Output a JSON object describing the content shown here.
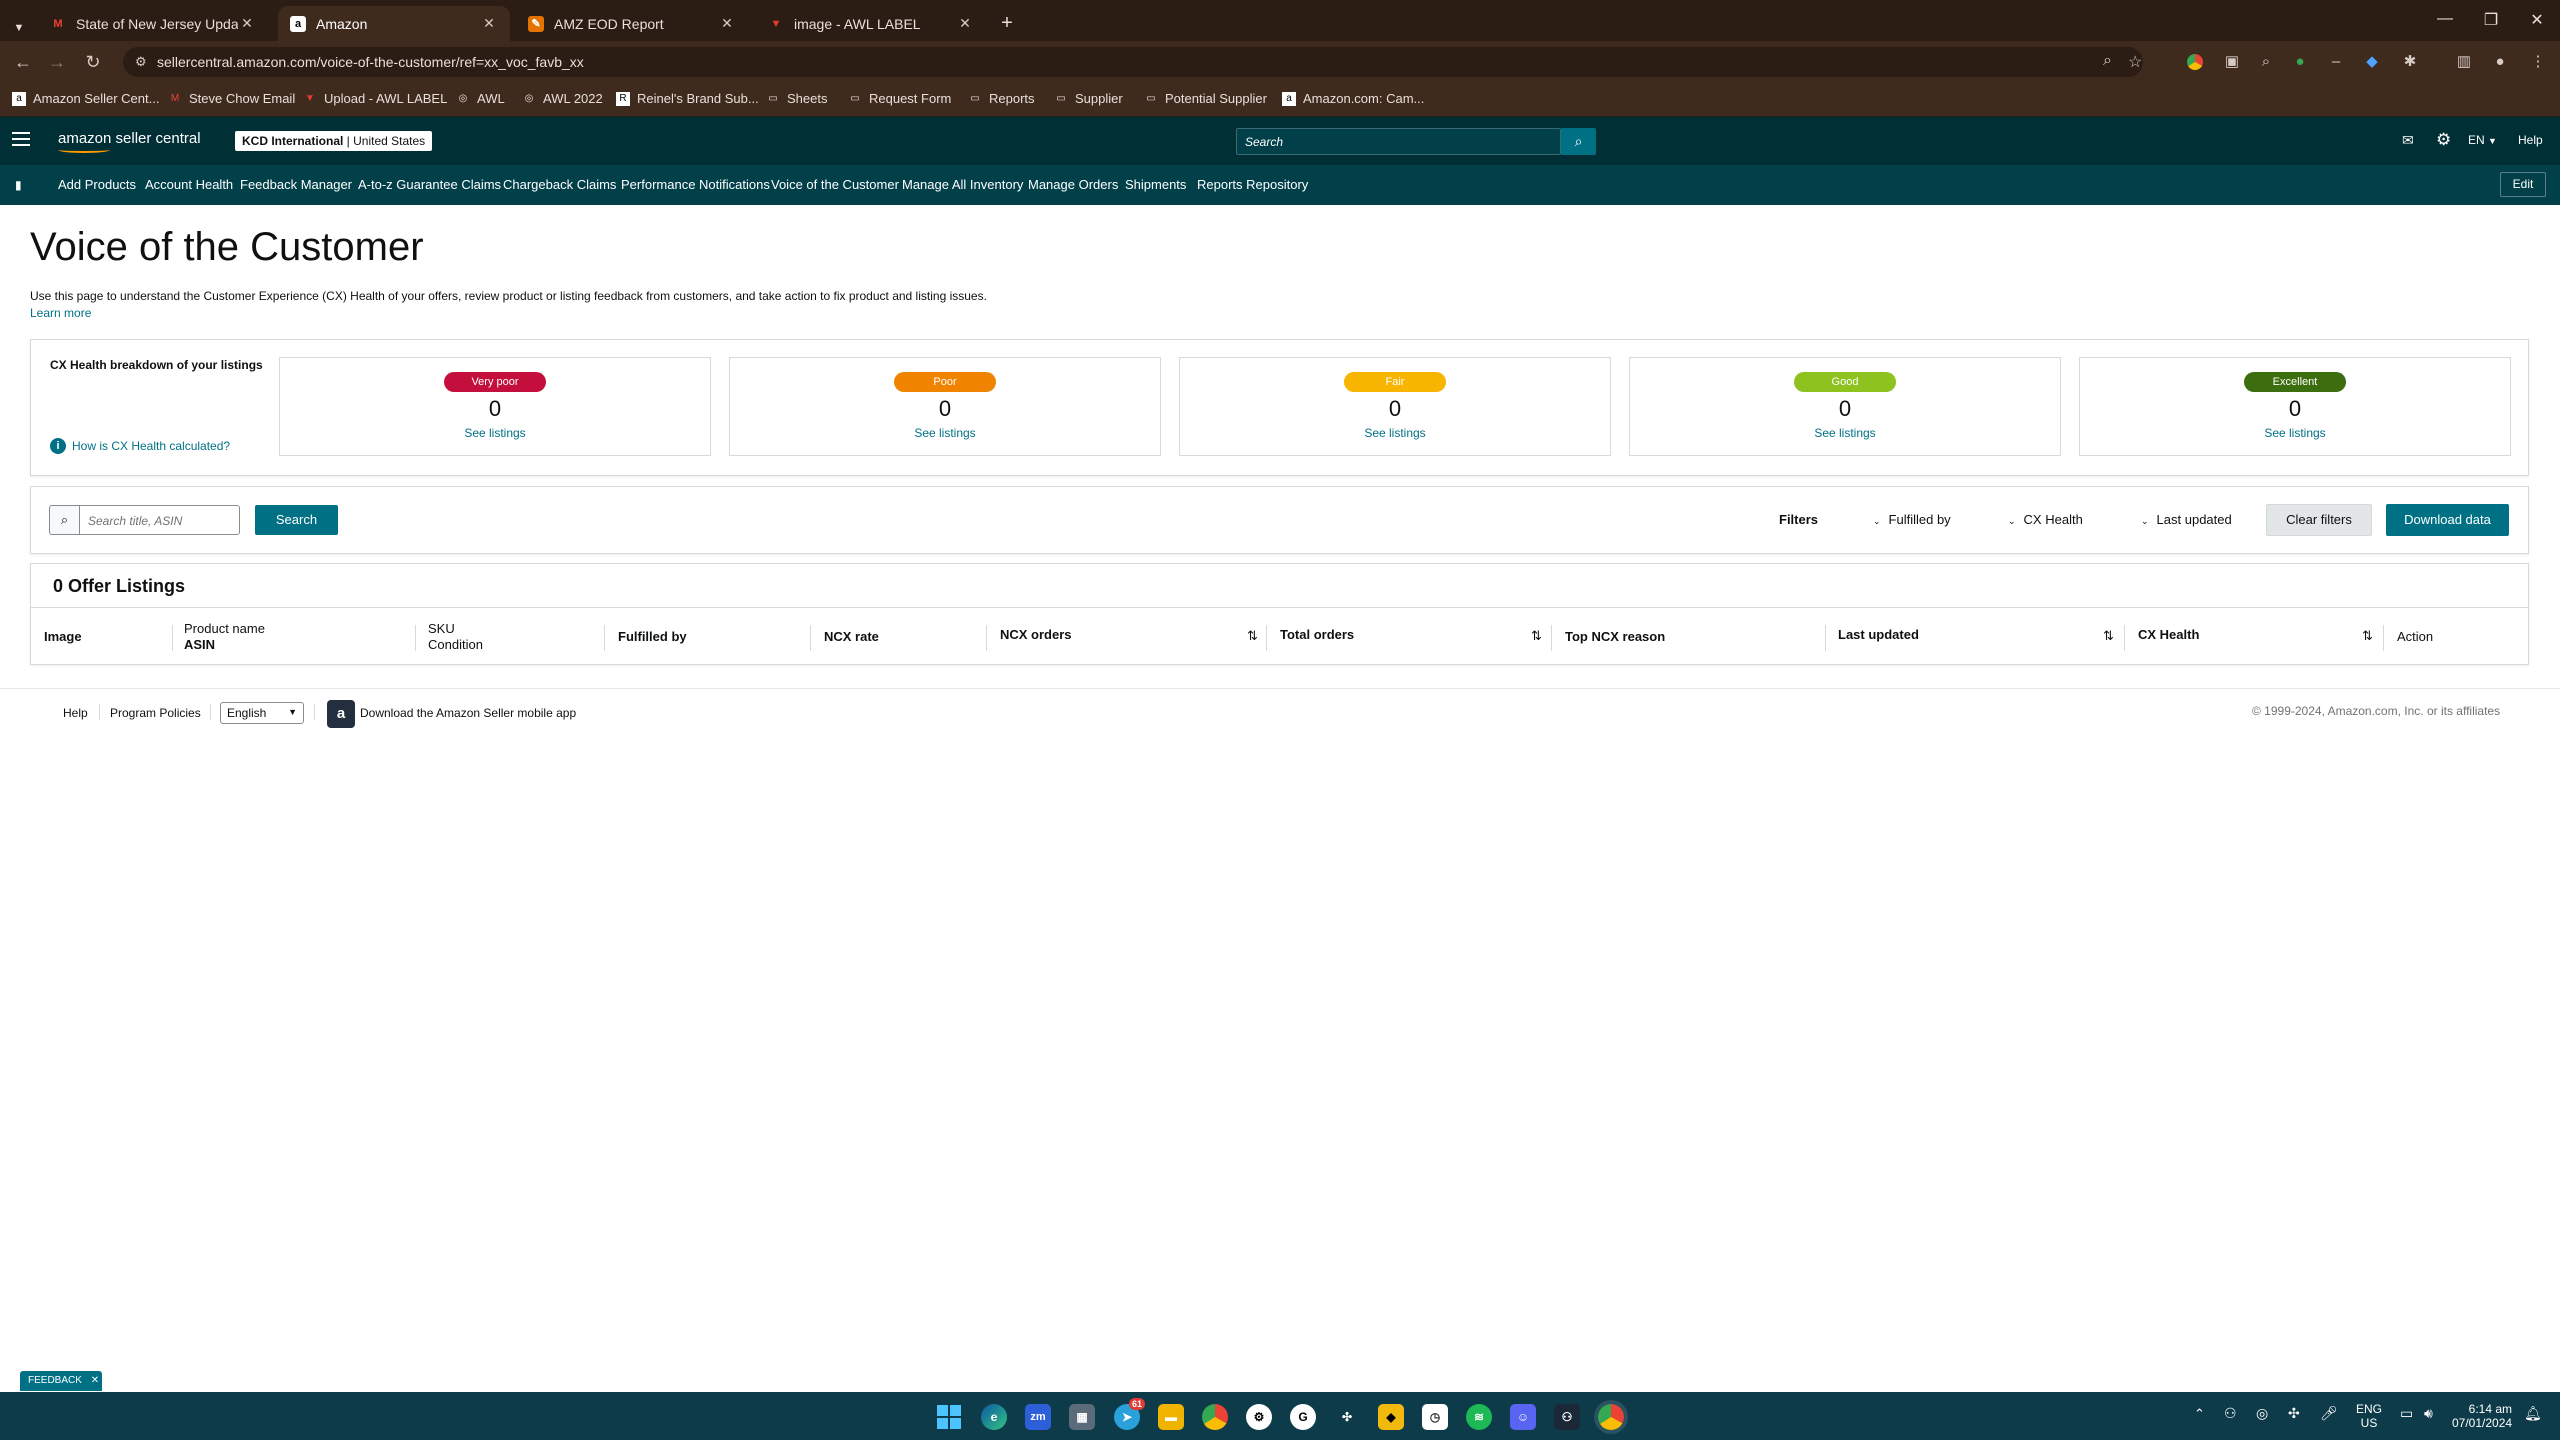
{
  "browser": {
    "tabs": [
      {
        "title": "State of New Jersey Update: Lat",
        "icon": "gmail-icon",
        "active": false
      },
      {
        "title": "Amazon",
        "icon": "amazon-icon",
        "active": true
      },
      {
        "title": "AMZ EOD Report",
        "icon": "sheets-icon",
        "active": false
      },
      {
        "title": "image - AWL LABEL",
        "icon": "awl-icon",
        "active": false
      }
    ],
    "url": "sellercentral.amazon.com/voice-of-the-customer/ref=xx_voc_favb_xx",
    "bookmarks": [
      "Amazon Seller Cent...",
      "Steve Chow Email",
      "Upload - AWL LABEL",
      "AWL",
      "AWL 2022",
      "Reinel's Brand Sub...",
      "Sheets",
      "Request Form",
      "Reports",
      "Supplier",
      "Potential Supplier",
      "Amazon.com: Cam..."
    ]
  },
  "header": {
    "logo_text": "amazon seller central",
    "account_name": "KCD International",
    "account_region": "United States",
    "search_placeholder": "Search",
    "language": "EN",
    "help": "Help"
  },
  "nav": {
    "items": [
      "Add Products",
      "Account Health",
      "Feedback Manager",
      "A-to-z Guarantee Claims",
      "Chargeback Claims",
      "Performance Notifications",
      "Voice of the Customer",
      "Manage All Inventory",
      "Manage Orders",
      "Shipments",
      "Reports Repository"
    ],
    "edit": "Edit"
  },
  "page": {
    "title": "Voice of the Customer",
    "description": "Use this page to understand the Customer Experience (CX) Health of your offers, review product or listing feedback from customers, and take action to fix product and listing issues.",
    "learn_more": "Learn more"
  },
  "health": {
    "heading": "CX Health breakdown of your listings",
    "how_link": "How is CX Health calculated?",
    "cards": [
      {
        "label": "Very poor",
        "count": "0",
        "link": "See listings",
        "color": "#c40f3c"
      },
      {
        "label": "Poor",
        "count": "0",
        "link": "See listings",
        "color": "#f08400"
      },
      {
        "label": "Fair",
        "count": "0",
        "link": "See listings",
        "color": "#f7b500"
      },
      {
        "label": "Good",
        "count": "0",
        "link": "See listings",
        "color": "#8ec21f"
      },
      {
        "label": "Excellent",
        "count": "0",
        "link": "See listings",
        "color": "#3c6e10"
      }
    ]
  },
  "filters": {
    "search_placeholder": "Search title, ASIN",
    "search_button": "Search",
    "label": "Filters",
    "fulfilled_by": "Fulfilled by",
    "cx_health": "CX Health",
    "last_updated": "Last updated",
    "clear": "Clear filters",
    "download": "Download data"
  },
  "listings": {
    "title": "0 Offer Listings",
    "columns": {
      "image": "Image",
      "product_name": "Product name",
      "asin": "ASIN",
      "sku": "SKU",
      "condition": "Condition",
      "fulfilled_by": "Fulfilled by",
      "ncx_rate": "NCX rate",
      "ncx_orders": "NCX orders",
      "total_orders": "Total orders",
      "top_ncx_reason": "Top NCX reason",
      "last_updated": "Last updated",
      "cx_health": "CX Health",
      "action": "Action"
    }
  },
  "footer": {
    "help": "Help",
    "program_policies": "Program Policies",
    "language_select": "English",
    "app_link": "Download the Amazon Seller mobile app",
    "copyright": "© 1999-2024, Amazon.com, Inc. or its affiliates"
  },
  "feedback_tab": "FEEDBACK",
  "taskbar": {
    "telegram_badge": "61",
    "lang_line1": "ENG",
    "lang_line2": "US",
    "time": "6:14 am",
    "date": "07/01/2024"
  }
}
